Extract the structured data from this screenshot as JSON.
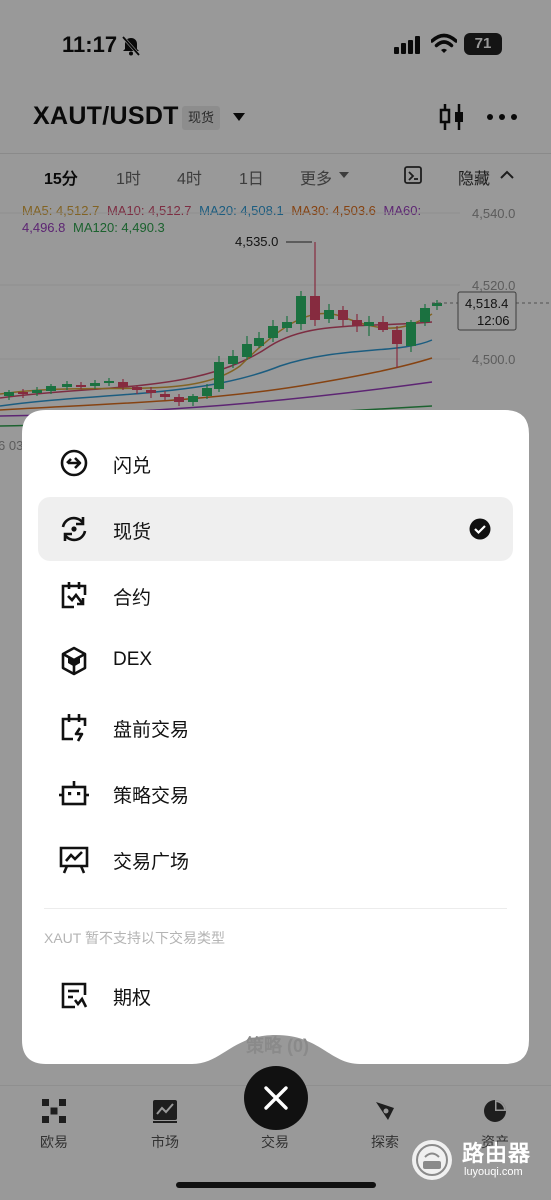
{
  "status_bar": {
    "time": "11:17",
    "battery": "71"
  },
  "header": {
    "pair": "XAUT/USDT",
    "badge": "现货"
  },
  "intervals": {
    "items": [
      "15分",
      "1时",
      "4时",
      "1日",
      "更多"
    ],
    "active": "15分",
    "hide_label": "隐藏"
  },
  "ma_legend": {
    "ma5": "MA5: 4,512.7",
    "ma10": "MA10: 4,512.7",
    "ma20": "MA20: 4,508.1",
    "ma30": "MA30: 4,503.6",
    "ma60_label": "MA60:",
    "ma60_value": "4,496.8",
    "ma120": "MA120: 4,490.3",
    "colors": {
      "ma5": "#d9a53b",
      "ma10": "#d14c6e",
      "ma20": "#2f9bd6",
      "ma30": "#e0701e",
      "ma60": "#9b3ec0",
      "ma120": "#2fa44f"
    }
  },
  "chart_data": {
    "type": "candlestick",
    "y_ticks": [
      "4,540.0",
      "4,520.0",
      "4,500.0"
    ],
    "high_label": "4,535.0",
    "last_price": "4,518.4",
    "countdown": "12:06",
    "x_tick_partial": "6 03",
    "colors": {
      "up": "#2ebd6b",
      "down": "#e0496a"
    }
  },
  "menu": {
    "items": [
      {
        "label": "闪兑",
        "icon": "swap-circle-icon",
        "selected": false
      },
      {
        "label": "现货",
        "icon": "spot-refresh-icon",
        "selected": true
      },
      {
        "label": "合约",
        "icon": "futures-calendar-icon",
        "selected": false
      },
      {
        "label": "DEX",
        "icon": "dex-cube-icon",
        "selected": false
      },
      {
        "label": "盘前交易",
        "icon": "premarket-calendar-icon",
        "selected": false
      },
      {
        "label": "策略交易",
        "icon": "strategy-bot-icon",
        "selected": false
      },
      {
        "label": "交易广场",
        "icon": "trading-square-icon",
        "selected": false
      }
    ],
    "unsupported_note": "XAUT 暂不支持以下交易类型",
    "unsupported_items": [
      {
        "label": "期权",
        "icon": "options-doc-icon"
      }
    ],
    "behind_tab_label": "策略 (0)"
  },
  "tabbar": {
    "items": [
      {
        "label": "欧易",
        "icon": "okx-logo-icon"
      },
      {
        "label": "市场",
        "icon": "market-chart-icon"
      },
      {
        "label": "交易",
        "icon": "trade-icon"
      },
      {
        "label": "探索",
        "icon": "explore-compass-icon"
      },
      {
        "label": "资产",
        "icon": "assets-pie-icon"
      }
    ]
  },
  "watermark": {
    "title": "路由器",
    "subtitle": "luyouqi.com"
  }
}
